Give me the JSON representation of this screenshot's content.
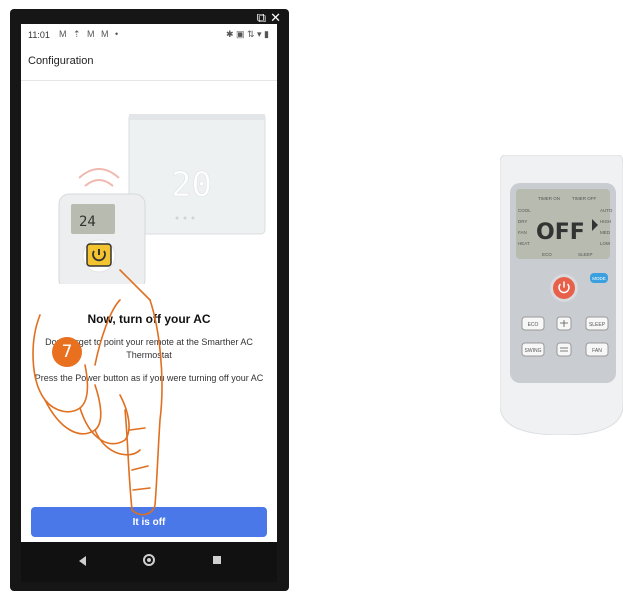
{
  "window_icons": {
    "popout": "⧉",
    "close": "✕"
  },
  "status_bar": {
    "time": "11:01",
    "notifications": "M ⇡ M M •",
    "system": "✱ ▣ ⇅ ▾ ▮"
  },
  "app_bar": {
    "title": "Configuration"
  },
  "illustration": {
    "thermostat_display": "20",
    "remote_display": "24"
  },
  "content": {
    "heading": "Now, turn off your AC",
    "instruction_1": "Don't forget to point your remote at the Smarther AC Thermostat",
    "instruction_2": "Press the Power button as if you were turning off your AC"
  },
  "cta": {
    "label": "It is off"
  },
  "step_badge": "7",
  "remote_large": {
    "timer_on": "TIMER ON",
    "timer_off": "TIMER OFF",
    "display": "OFF",
    "modes_left": [
      "COOL",
      "DRY",
      "FAN",
      "HEAT"
    ],
    "modes_right": [
      "AUTO",
      "HIGH",
      "MED",
      "LOW"
    ],
    "eco_label": "ECO",
    "sleep_label": "SLEEP",
    "mode_button": "MODE",
    "buttons": {
      "eco": "ECO",
      "sleep": "SLEEP",
      "swing": "SWING",
      "fan": "FAN"
    }
  },
  "colors": {
    "accent": "#4a78e8",
    "badge": "#e8701e",
    "power": "#e8604a",
    "remote_lcd": "#b8bbb0"
  }
}
